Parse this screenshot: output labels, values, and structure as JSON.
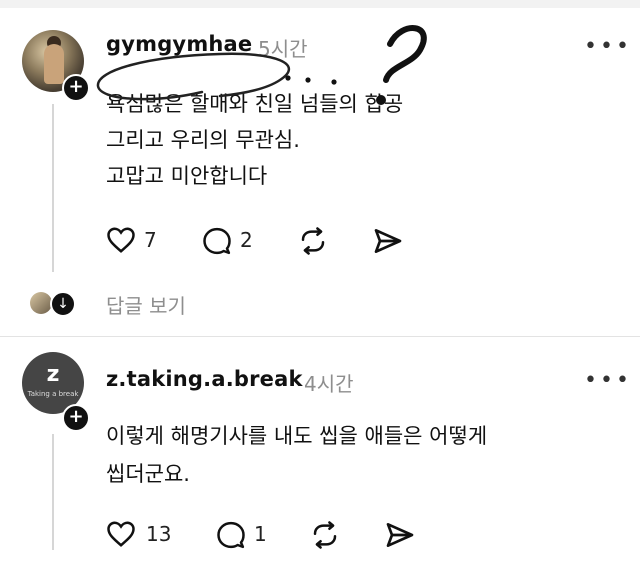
{
  "posts": [
    {
      "username": "gymgymhae",
      "time": "5시간",
      "lines": [
        "욕심많은 할매와 친일 넘들의 합공",
        "그리고 우리의 무관심.",
        "고맙고 미안합니다"
      ],
      "likes": "7",
      "comments": "2"
    },
    {
      "username": "z.taking.a.break",
      "time": "4시간",
      "avatar_letter": "z",
      "avatar_tagline": "Taking a break",
      "lines": [
        "이렇게 해명기사를 내도 씹을 애들은 어떻게",
        "씹더군요."
      ],
      "likes": "13",
      "comments": "1"
    }
  ],
  "view_replies": "답글 보기",
  "more_icon": "more-dots-icon",
  "annotation": {
    "text": "?",
    "dots": "..."
  },
  "colors": {
    "muted": "#8e8e8e",
    "text": "#111111",
    "thread": "#d6d6d6"
  }
}
